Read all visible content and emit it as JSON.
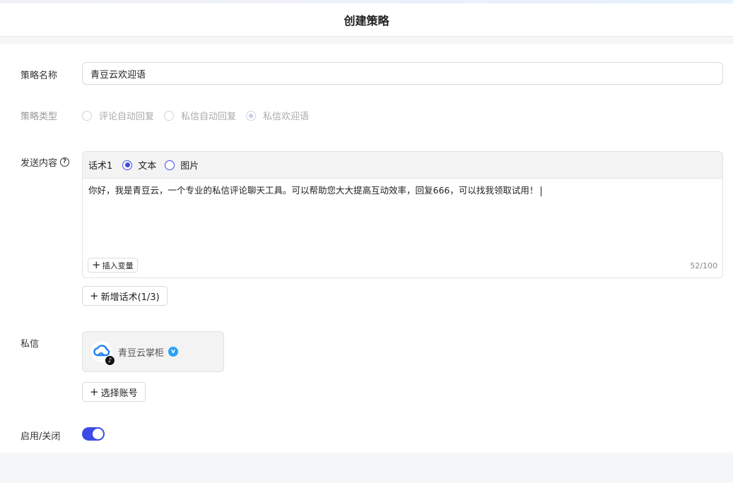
{
  "header": {
    "title": "创建策略"
  },
  "form": {
    "name": {
      "label": "策略名称",
      "value": "青豆云欢迎语"
    },
    "type": {
      "label": "策略类型",
      "options": [
        "评论自动回复",
        "私信自动回复",
        "私信欢迎语"
      ],
      "selected": "私信欢迎语"
    },
    "content": {
      "label": "发送内容",
      "help_icon": "question-circle-icon",
      "script_name": "话术1",
      "format_options": [
        "文本",
        "图片"
      ],
      "format_selected": "文本",
      "text": "你好，我是青豆云，一个专业的私信评论聊天工具。可以帮助您大大提高互动效率，回复666，可以找我领取试用！",
      "insert_variable_label": "插入变量",
      "counter": "52/100",
      "add_script_label": "新增话术(1/3)"
    },
    "private_message": {
      "label": "私信",
      "account_name": "青豆云掌柜",
      "select_account_label": "选择账号"
    },
    "enable": {
      "label": "启用/关闭",
      "enabled": true
    }
  },
  "colors": {
    "primary": "#3d4be6",
    "verified": "#29a3f5",
    "cloud_logo": "#1e7df0"
  }
}
